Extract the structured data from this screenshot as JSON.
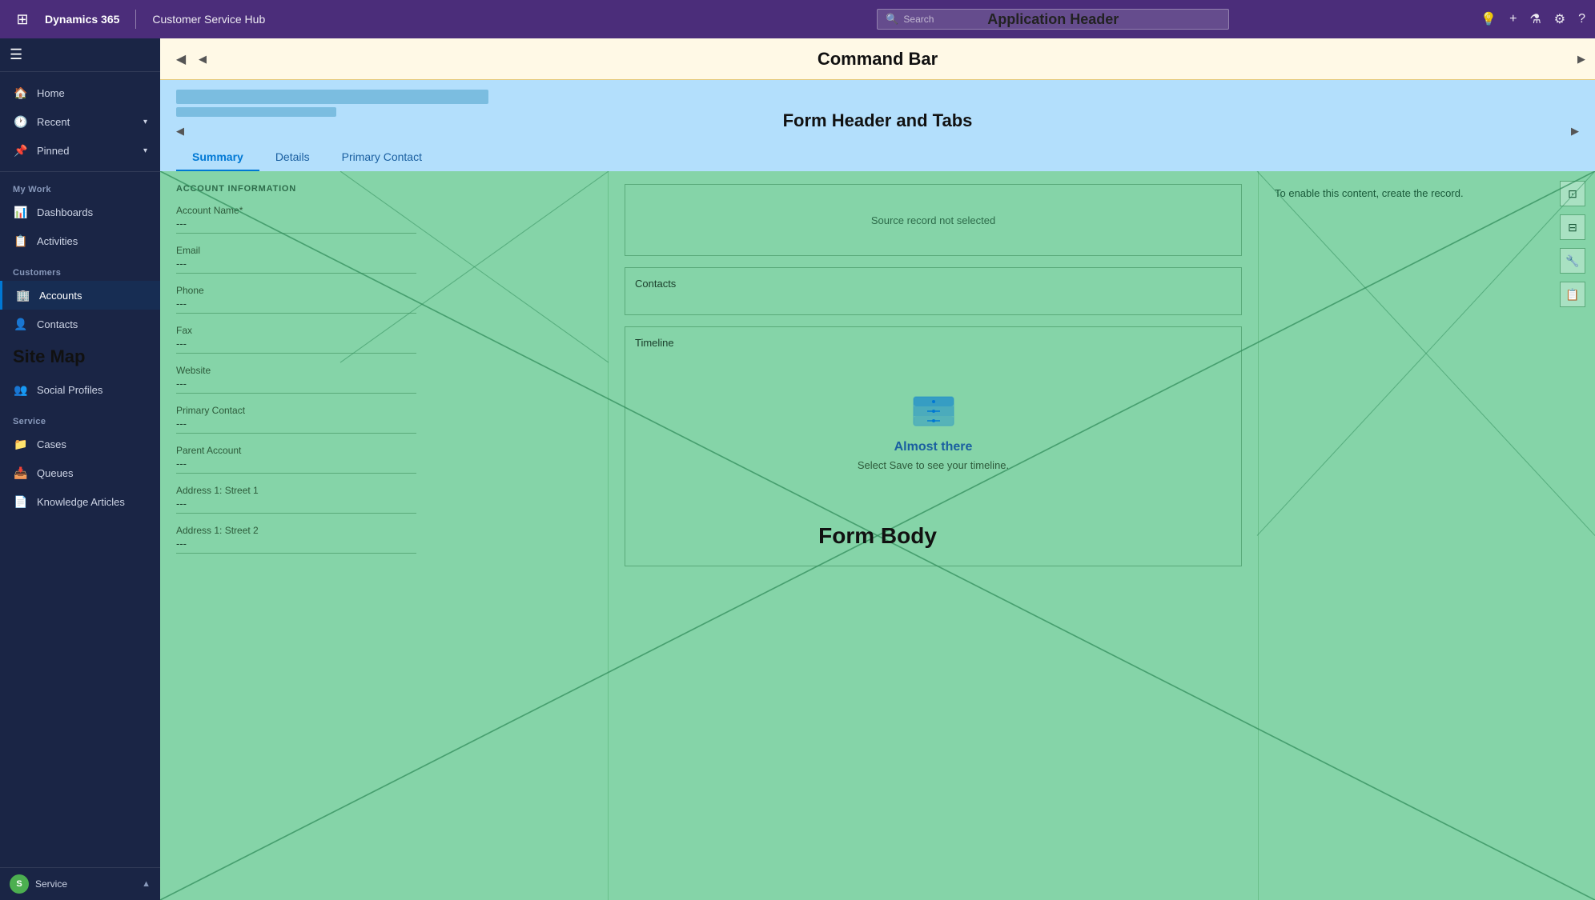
{
  "app_header": {
    "waffle_icon": "⊞",
    "brand_name": "Dynamics 365",
    "module_name": "Customer Service Hub",
    "search_placeholder": "Search",
    "label": "Application Header",
    "icons": {
      "lightbulb": "💡",
      "plus": "+",
      "funnel": "⚗",
      "gear": "⚙",
      "question": "?"
    }
  },
  "command_bar": {
    "label": "Command Bar",
    "back_icon": "◀",
    "arrow_left": "◀",
    "arrow_right": "▶"
  },
  "form_header": {
    "label": "Form Header and Tabs",
    "arrow_left": "◀",
    "arrow_right": "▶",
    "tabs": [
      {
        "label": "Summary",
        "active": true
      },
      {
        "label": "Details",
        "active": false
      },
      {
        "label": "Primary Contact",
        "active": false
      }
    ]
  },
  "form_body": {
    "label": "Form Body",
    "left_col": {
      "section_title": "ACCOUNT INFORMATION",
      "fields": [
        {
          "label": "Account Name*",
          "value": "---"
        },
        {
          "label": "Email",
          "value": "---"
        },
        {
          "label": "Phone",
          "value": "---"
        },
        {
          "label": "Fax",
          "value": "---"
        },
        {
          "label": "Website",
          "value": "---"
        },
        {
          "label": "Primary Contact",
          "value": "---"
        },
        {
          "label": "Parent Account",
          "value": "---"
        },
        {
          "label": "Address 1: Street 1",
          "value": "---"
        },
        {
          "label": "Address 1: Street 2",
          "value": "---"
        }
      ]
    },
    "middle_col": {
      "source_record_text": "Source record not selected",
      "contacts_label": "Contacts",
      "timeline_label": "Timeline",
      "timeline_empty_title": "Almost there",
      "timeline_empty_sub": "Select Save to see your timeline."
    },
    "right_col": {
      "enable_msg": "To enable this content, create the record.",
      "icons": [
        "⊡",
        "⊟",
        "🔧",
        "📋"
      ]
    }
  },
  "sidebar": {
    "hamburger": "☰",
    "items_top": [
      {
        "label": "Home",
        "icon": "🏠"
      },
      {
        "label": "Recent",
        "icon": "🕐",
        "has_chevron": true
      },
      {
        "label": "Pinned",
        "icon": "📌",
        "has_chevron": true
      }
    ],
    "sections": [
      {
        "label": "My Work",
        "items": [
          {
            "label": "Dashboards",
            "icon": "📊"
          },
          {
            "label": "Activities",
            "icon": "📋"
          }
        ]
      },
      {
        "label": "Customers",
        "items": [
          {
            "label": "Accounts",
            "icon": "🏢",
            "active": true
          },
          {
            "label": "Contacts",
            "icon": "👤"
          }
        ]
      },
      {
        "label": "Site Map",
        "items": [
          {
            "label": "Social Profiles",
            "icon": "👥"
          }
        ]
      },
      {
        "label": "Service",
        "items": [
          {
            "label": "Cases",
            "icon": "📁"
          },
          {
            "label": "Queues",
            "icon": "📥"
          },
          {
            "label": "Knowledge Articles",
            "icon": "📄"
          }
        ]
      }
    ]
  },
  "bottom_bar": {
    "avatar_text": "S",
    "service_label": "Service",
    "chevron": "▲"
  }
}
